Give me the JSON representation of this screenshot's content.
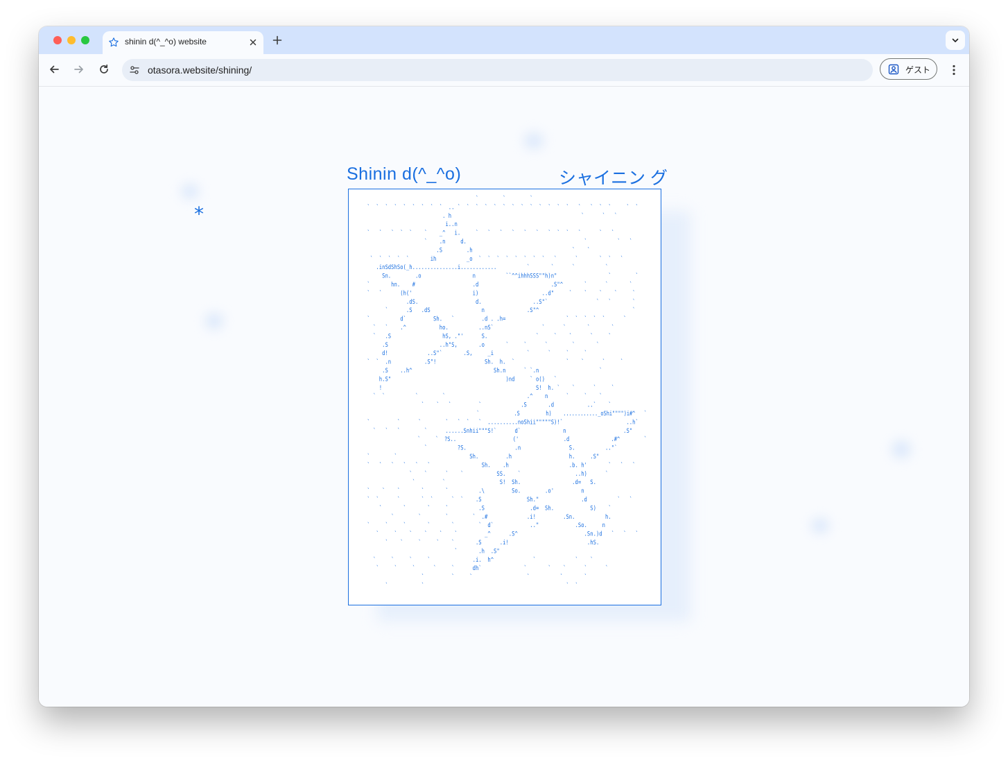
{
  "browser": {
    "tab": {
      "title": "shinin d(^_^o) website",
      "favicon": "star-icon"
    },
    "url": "otasora.website/shining/",
    "profile_label": "ゲスト",
    "icons": [
      "back-arrow-icon",
      "forward-arrow-icon",
      "reload-icon",
      "site-settings-icon",
      "person-icon",
      "more-vert-icon",
      "close-icon",
      "plus-icon",
      "chevron-down-icon"
    ]
  },
  "page": {
    "title_left": "Shinin d(^_^o)",
    "title_right": "シャイニン グ",
    "asterisk": "*",
    "accent_color": "#1a6fe0",
    "ascii_art": [
      "                                     `        `        `",
      " `  `  `  `  `  `  `  `  `  .. `  `  `  `  `  `  `  `  `  `  `  `  `   `   `  `  `     `  `",
      "                          . h                                           `      `   `",
      "                           i..n",
      " `   `   `  `  `    `    _^   i.     `   `   `   `   `   `   `  `  `   `      `   `",
      "                    `    .n     d.                                       `          `   `",
      "                        .S        .h                                 `    `",
      "  `  `  `  `  `       ih          _o  `  `  `  `  `  `  `  `   `      `       `  `   `",
      "    .inSdShSo(_h...............i............          `       `      `          `",
      "      Sn.        .o                 n          ``^^ihhhSSS\"\"h)n\"                 `        `",
      " `       hn.    #                   .d                        .S\"^       `      `       `",
      " `   `      (h('                    i)                     ..d\"     `    `    `    `     `",
      "              .dS.                   d.                 ..S\"`                `   `       `",
      "       `      .S   .dS                 n              .S\"^                               `",
      " `          d`         Sh.   `         .d . .h=                    `  `  `  `  `      `",
      "   `   `    .^           ho.          ..nS`                `      `       `       `",
      "   `   .S                 hS, .\"'      S.                `     `    `      `     `",
      "      .S                 ..h\"S,       .o       `     `      `        `       `",
      "      d!             ..S\"`       .S,     _i           `      `     `     `",
      " `  `  .n           .S\"!                Sh.  h.  `                 `    `      `     `",
      "      .S    ..h^                           Sh.n      ` `.n                    `",
      "     h.S\"                                      )nd     ` o()   `",
      "     !                                                   S!  h. `    `      `     `",
      "   `  `          `        `                           .^    n      `     `    `",
      "                   `    `   `         `             .S       .d           ..`    `",
      "                                       `            .S         h)    ............_oShi\"\"\"\")i#^   `",
      " `         `      `        `   `  `   `  ..........noShii\"\"\"\"\"S)!`                     ..h`",
      "   `   `   `        `      ......Snhii\"\"\"S!`      d`              n                   .S\"",
      "                  `     `  ?S..                   ('               .d              .#^        `",
      "                    `          ?S.                .n                S.          ..\"`",
      " `        `                        Sh.         .h                   h.     .S\"",
      " `   `   `   `   `   `                 Sh.    .h                    .b. h'       `   `   `",
      "               `    `      `    `           SS.    `                  ..h)      `",
      "                `         `                  S!  Sh.                 .d=   S.",
      " `    `    `       `       `          .\\         So.        .o'         n",
      " `  `      `       `  `      `  `    .S               Sh.\"              .d          `   `",
      "     `       `       `     `          .S               .d=  Sh.            S)    `",
      "         `        `        `        `  .#             .i!         .Sn.          h.",
      " `     `     `       `       `        `  d`            ..\"            .So.     n",
      "    `     `    `    `    `    `         _^      .S^                      .Sn.)d   `   `   `",
      "       `    `     `     `    `       .S      .i!                          .hS.",
      "                              `       .h  .S\"",
      "   `     `     `     `              .i.  h^             `             `    `",
      "    `     `     `      `     `      dh`              `       `    `      `      `",
      "                   `         `     `                  `          `       `",
      "       `           `                                               `  `"
    ]
  }
}
